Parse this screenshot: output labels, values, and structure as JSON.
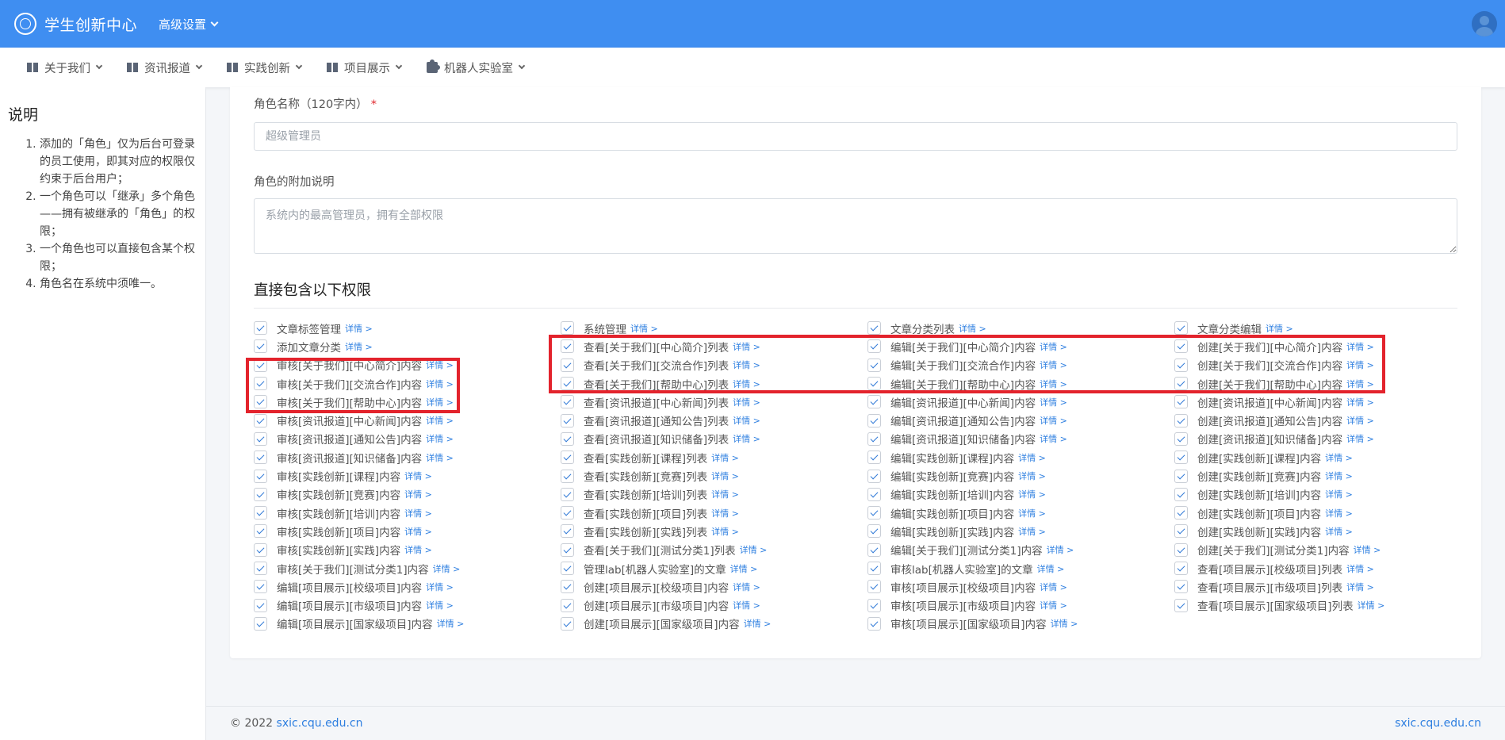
{
  "header": {
    "brand_title": "学生创新中心",
    "advanced_settings": "高级设置"
  },
  "nav": {
    "items": [
      {
        "label": "关于我们",
        "icon": "book-icon"
      },
      {
        "label": "资讯报道",
        "icon": "book-icon"
      },
      {
        "label": "实践创新",
        "icon": "book-icon"
      },
      {
        "label": "项目展示",
        "icon": "book-icon"
      },
      {
        "label": "机器人实验室",
        "icon": "puzzle-icon"
      }
    ]
  },
  "sidebar": {
    "title": "说明",
    "notes": [
      "添加的「角色」仅为后台可登录的员工使用，即其对应的权限仅约束于后台用户；",
      "一个角色可以「继承」多个角色——拥有被继承的「角色」的权限；",
      "一个角色也可以直接包含某个权限；",
      "角色名在系统中须唯一。"
    ]
  },
  "form": {
    "role_name_label": "角色名称（120字内）",
    "required_mark": "*",
    "role_name_placeholder": "超级管理员",
    "role_desc_label": "角色的附加说明",
    "role_desc_placeholder": "系统内的最高管理员，拥有全部权限",
    "perm_section_title": "直接包含以下权限",
    "detail_link": "详情 >"
  },
  "permissions": [
    "文章标签管理",
    "系统管理",
    "文章分类列表",
    "文章分类编辑",
    "添加文章分类",
    "查看[关于我们][中心简介]列表",
    "编辑[关于我们][中心简介]内容",
    "创建[关于我们][中心简介]内容",
    "审核[关于我们][中心简介]内容",
    "查看[关于我们][交流合作]列表",
    "编辑[关于我们][交流合作]内容",
    "创建[关于我们][交流合作]内容",
    "审核[关于我们][交流合作]内容",
    "查看[关于我们][帮助中心]列表",
    "编辑[关于我们][帮助中心]内容",
    "创建[关于我们][帮助中心]内容",
    "审核[关于我们][帮助中心]内容",
    "查看[资讯报道][中心新闻]列表",
    "编辑[资讯报道][中心新闻]内容",
    "创建[资讯报道][中心新闻]内容",
    "审核[资讯报道][中心新闻]内容",
    "查看[资讯报道][通知公告]列表",
    "编辑[资讯报道][通知公告]内容",
    "创建[资讯报道][通知公告]内容",
    "审核[资讯报道][通知公告]内容",
    "查看[资讯报道][知识储备]列表",
    "编辑[资讯报道][知识储备]内容",
    "创建[资讯报道][知识储备]内容",
    "审核[资讯报道][知识储备]内容",
    "查看[实践创新][课程]列表",
    "编辑[实践创新][课程]内容",
    "创建[实践创新][课程]内容",
    "审核[实践创新][课程]内容",
    "查看[实践创新][竞赛]列表",
    "编辑[实践创新][竞赛]内容",
    "创建[实践创新][竞赛]内容",
    "审核[实践创新][竞赛]内容",
    "查看[实践创新][培训]列表",
    "编辑[实践创新][培训]内容",
    "创建[实践创新][培训]内容",
    "审核[实践创新][培训]内容",
    "查看[实践创新][项目]列表",
    "编辑[实践创新][项目]内容",
    "创建[实践创新][项目]内容",
    "审核[实践创新][项目]内容",
    "查看[实践创新][实践]列表",
    "编辑[实践创新][实践]内容",
    "创建[实践创新][实践]内容",
    "审核[实践创新][实践]内容",
    "查看[关于我们][测试分类1]列表",
    "编辑[关于我们][测试分类1]内容",
    "创建[关于我们][测试分类1]内容",
    "审核[关于我们][测试分类1]内容",
    "管理lab[机器人实验室]的文章",
    "审核lab[机器人实验室]的文章",
    "查看[项目展示][校级项目]列表",
    "编辑[项目展示][校级项目]内容",
    "创建[项目展示][校级项目]内容",
    "审核[项目展示][校级项目]内容",
    "查看[项目展示][市级项目]列表",
    "编辑[项目展示][市级项目]内容",
    "创建[项目展示][市级项目]内容",
    "审核[项目展示][市级项目]内容",
    "查看[项目展示][国家级项目]列表",
    "编辑[项目展示][国家级项目]内容",
    "创建[项目展示][国家级项目]内容",
    "审核[项目展示][国家级项目]内容"
  ],
  "footer": {
    "copyright": "© 2022",
    "left_link": "sxic.cqu.edu.cn",
    "right_link": "sxic.cqu.edu.cn"
  },
  "colors": {
    "header_bg": "#3f8ef1",
    "accent": "#2e7fe0",
    "highlight_box": "#e3232c"
  }
}
